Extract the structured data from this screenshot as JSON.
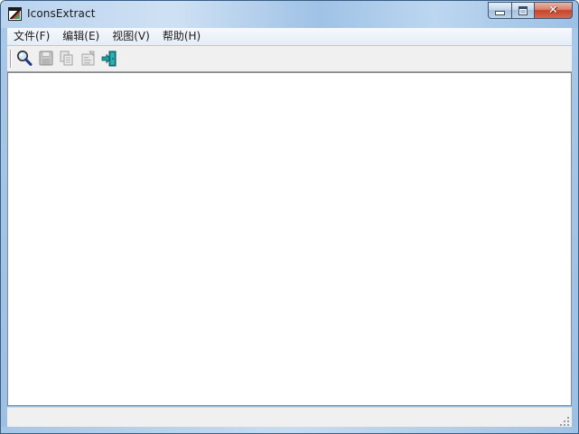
{
  "window": {
    "title": "IconsExtract"
  },
  "menu": {
    "items": [
      {
        "label": "文件(F)"
      },
      {
        "label": "编辑(E)"
      },
      {
        "label": "视图(V)"
      },
      {
        "label": "帮助(H)"
      }
    ]
  },
  "toolbar": {
    "buttons": [
      {
        "icon": "search-icon",
        "enabled": true
      },
      {
        "icon": "save-icon",
        "enabled": false
      },
      {
        "icon": "copy-icon",
        "enabled": false
      },
      {
        "icon": "properties-icon",
        "enabled": false
      },
      {
        "icon": "exit-icon",
        "enabled": true
      }
    ]
  },
  "statusbar": {
    "text": ""
  },
  "colors": {
    "title_gradient": "#9fc2e6",
    "close_button": "#c7452c",
    "content_bg": "#ffffff",
    "chrome_bg": "#f0f0f0"
  }
}
